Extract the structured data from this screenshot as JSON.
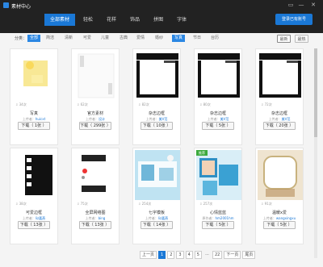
{
  "window": {
    "title": "素材中心",
    "controls": [
      "▭",
      "—",
      "✕"
    ]
  },
  "tabs": [
    "全部素材",
    "轻松",
    "花样",
    "饰品",
    "拼图",
    "字体"
  ],
  "signin": "登录已有账号",
  "filter": {
    "label": "分类：",
    "categories": [
      "全部",
      "简洁",
      "清新",
      "可爱",
      "儿童",
      "古典",
      "爱情",
      "婚纱",
      "写真",
      "节日",
      "台历"
    ],
    "active_index": 8,
    "sort": [
      "最新",
      "最热"
    ],
    "active_sort": 0
  },
  "cards": [
    {
      "count": "34次",
      "title": "写真",
      "uploader_prefix": "上传者：",
      "uploader": "huicxt",
      "download": "下载（ 1张 ）",
      "badge": ""
    },
    {
      "count": "62次",
      "title": "官方素材",
      "uploader_prefix": "上传者：",
      "uploader": "设计",
      "download": "下载（ 299张 ）",
      "badge": ""
    },
    {
      "count": "82次",
      "title": "杂志边框",
      "uploader_prefix": "上传者：",
      "uploader": "美V范",
      "download": "下载（ 10张 ）",
      "badge": ""
    },
    {
      "count": "80次",
      "title": "杂志边框",
      "uploader_prefix": "上传者：",
      "uploader": "美V范",
      "download": "下载（ 5张 ）",
      "badge": ""
    },
    {
      "count": "72次",
      "title": "杂志边框",
      "uploader_prefix": "上传者：",
      "uploader": "美V范",
      "download": "下载（ 20张 ）",
      "badge": ""
    },
    {
      "count": "38次",
      "title": "可爱边框",
      "uploader_prefix": "上传者：",
      "uploader": "liz嘉燕",
      "download": "下载（ 13张 ）",
      "badge": ""
    },
    {
      "count": "75次",
      "title": "全屏网络图",
      "uploader_prefix": "上传者：",
      "uploader": "bing",
      "download": "下载（ 13张 ）",
      "badge": ""
    },
    {
      "count": "254次",
      "title": "七字模板",
      "uploader_prefix": "上传者：",
      "uploader": "liz嘉燕",
      "download": "下载（ 14张 ）",
      "badge": ""
    },
    {
      "count": "257次",
      "title": "心情蓝蓝",
      "uploader_prefix": "原作者：",
      "uploader": "hm2001hm",
      "download": "下载（ 5张 ）",
      "badge": "推荐"
    },
    {
      "count": "91次",
      "title": "温暖x爱",
      "uploader_prefix": "上传者：",
      "uploader": "wangxingxu",
      "download": "下载（ 5张 ）",
      "badge": ""
    }
  ],
  "pager": {
    "prev": "上一页",
    "pages": [
      "1",
      "2",
      "3",
      "4",
      "5",
      "...",
      "22"
    ],
    "active": "1",
    "next": "下一页",
    "last": "尾页"
  }
}
